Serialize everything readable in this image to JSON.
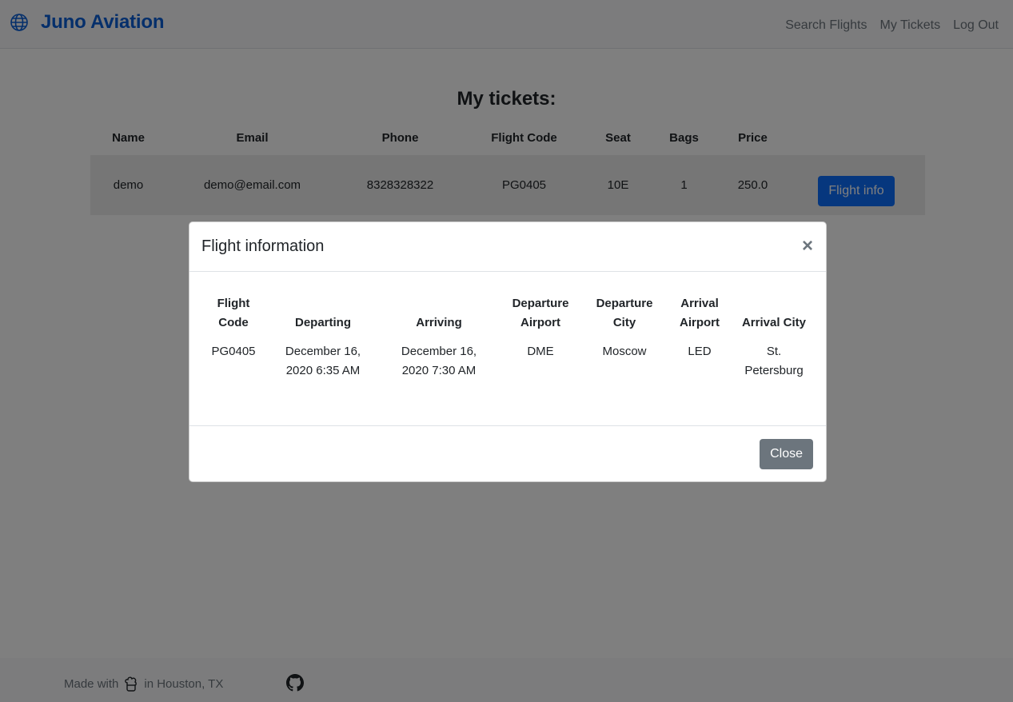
{
  "navbar": {
    "brand": "Juno Aviation",
    "links": [
      "Search Flights",
      "My Tickets",
      "Log Out"
    ]
  },
  "main": {
    "title": "My tickets:",
    "columns": [
      "Name",
      "Email",
      "Phone",
      "Flight Code",
      "Seat",
      "Bags",
      "Price",
      ""
    ],
    "rows": [
      {
        "name": "demo",
        "email": "demo@email.com",
        "phone": "8328328322",
        "flight_code": "PG0405",
        "seat": "10E",
        "bags": "1",
        "price": "250.0",
        "action": "Flight info"
      }
    ]
  },
  "modal": {
    "title": "Flight information",
    "close_symbol": "×",
    "columns": [
      "Flight Code",
      "Departing",
      "Arriving",
      "Departure Airport",
      "Departure City",
      "Arrival Airport",
      "Arrival City"
    ],
    "row": {
      "flight_code": "PG0405",
      "departing": "December 16, 2020 6:35 AM",
      "arriving": "December 16, 2020 7:30 AM",
      "departure_airport": "DME",
      "departure_city": "Moscow",
      "arrival_airport": "LED",
      "arrival_city": "St. Petersburg"
    },
    "close_button": "Close"
  },
  "footer": {
    "made_with": "Made with",
    "location": "in Houston, TX"
  },
  "icons": {
    "brand": "globe-icon",
    "footer_made_with": "chef-icon",
    "footer_link": "github-icon"
  },
  "colors": {
    "brand": "#0b5ed7",
    "primary_button": "#0d6efd",
    "secondary_button": "#6c757d"
  }
}
